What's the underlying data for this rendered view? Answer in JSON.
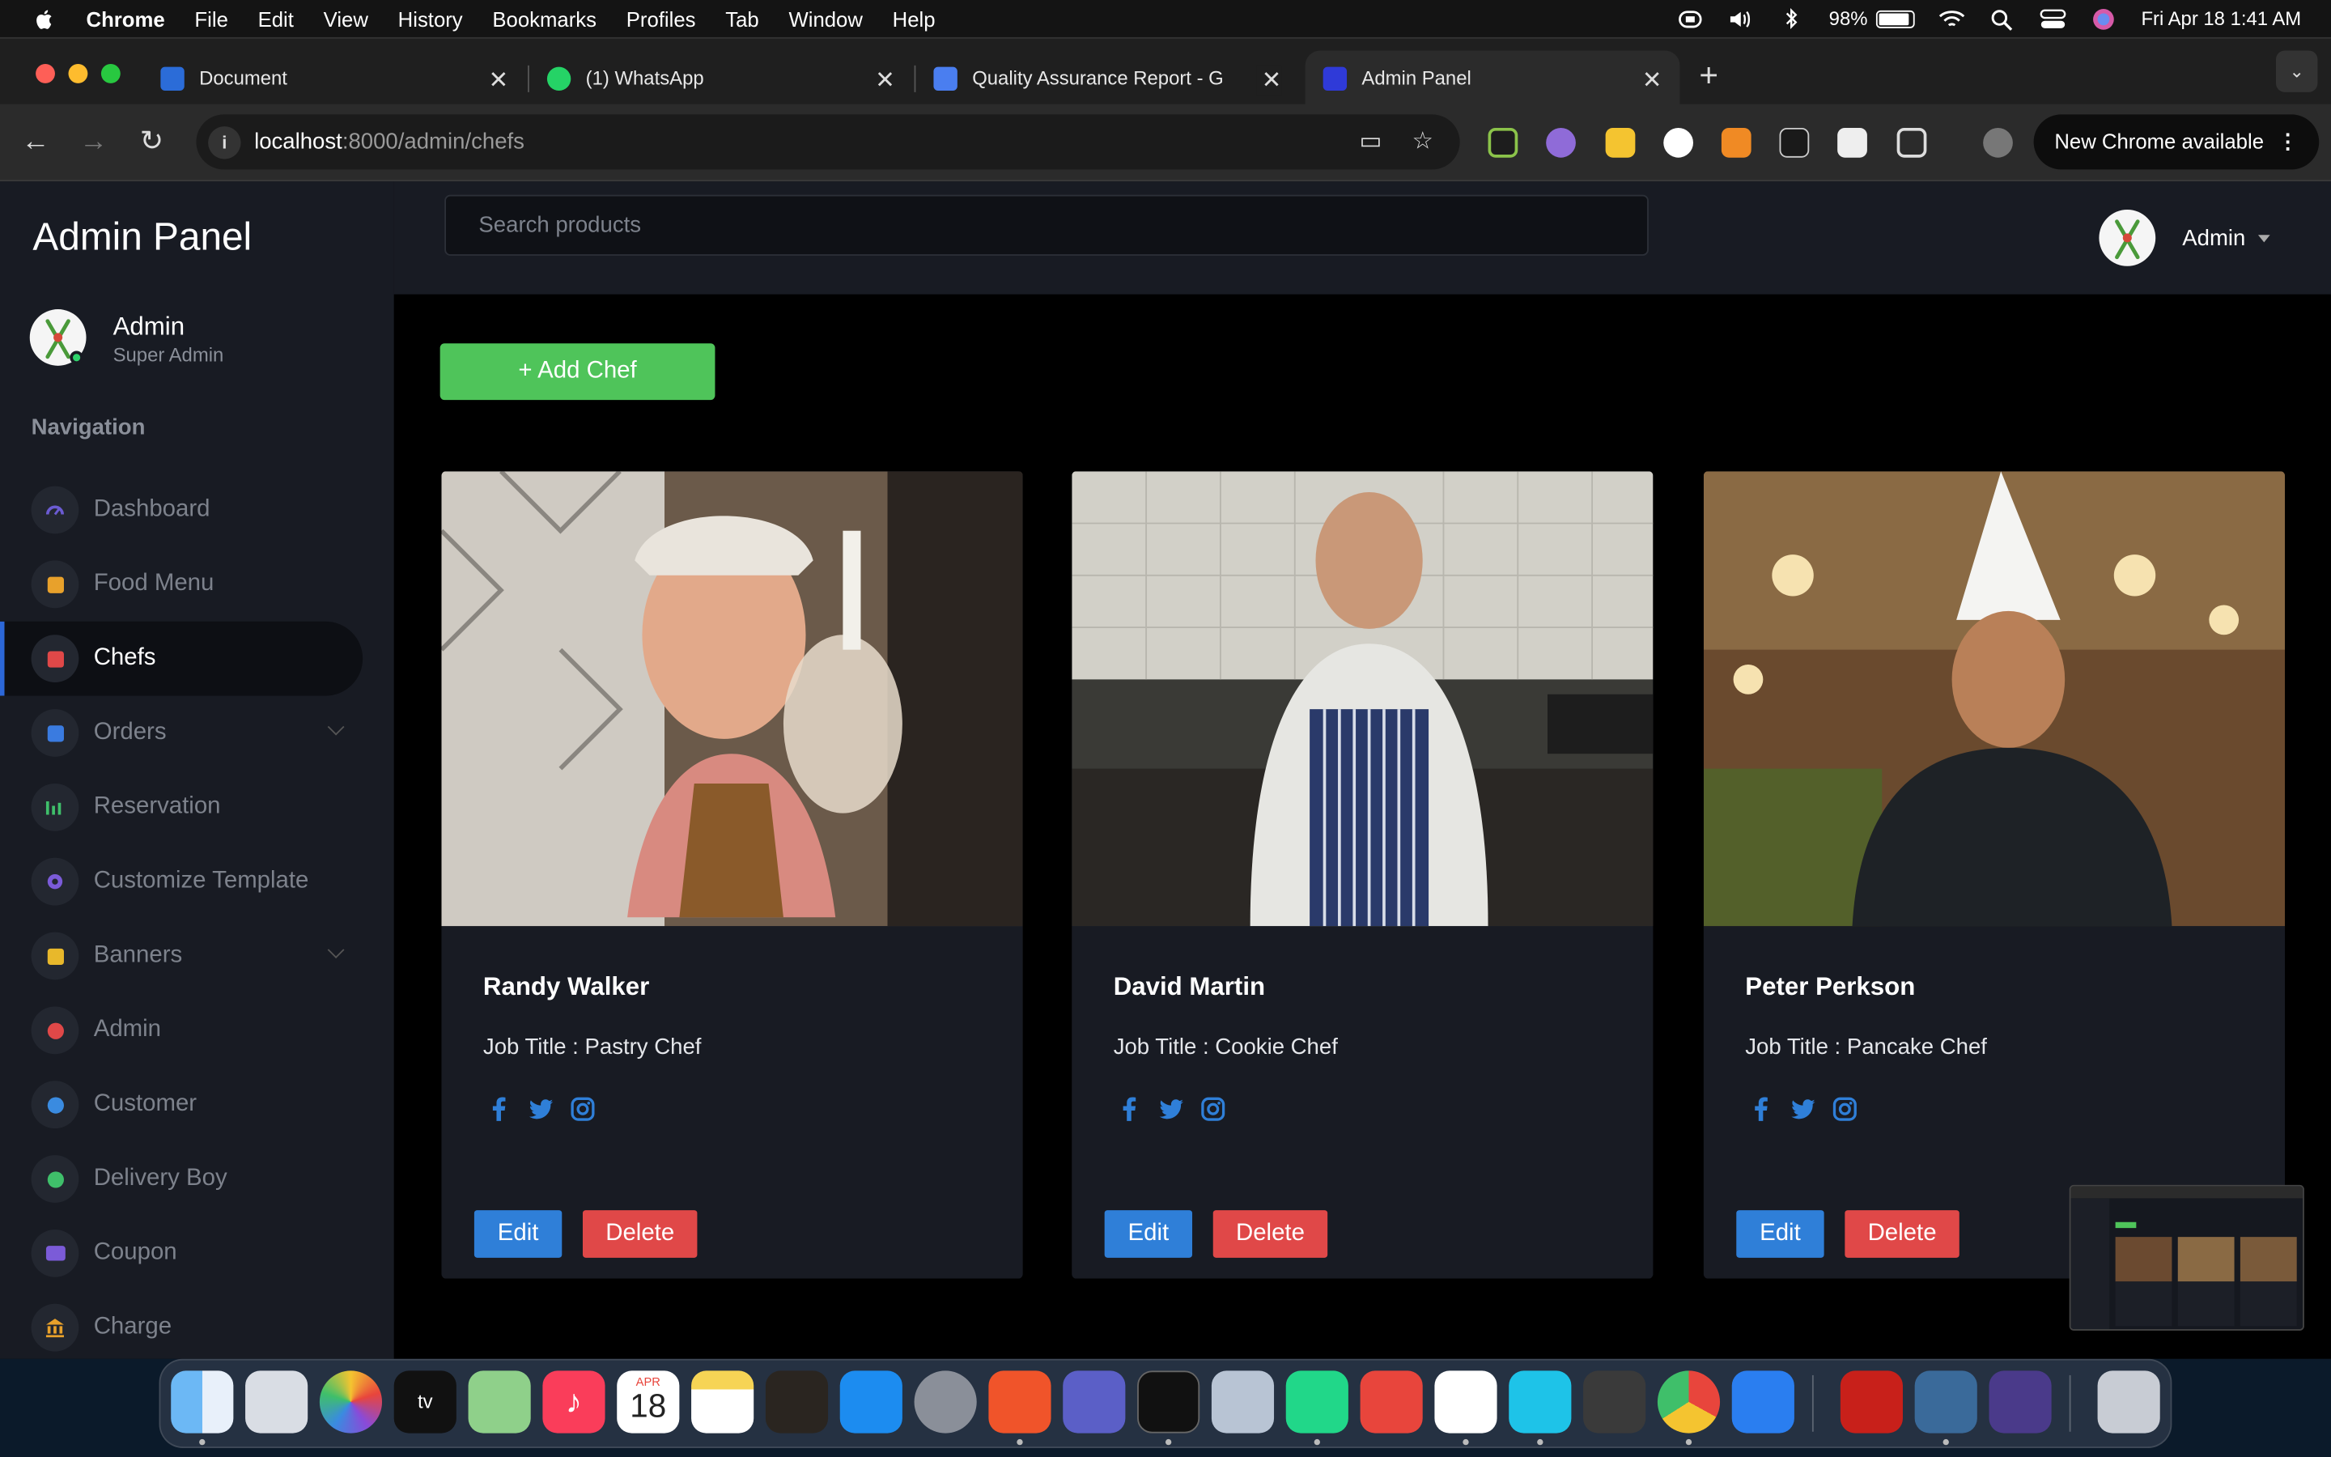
{
  "menubar": {
    "app_name": "Chrome",
    "items": [
      "File",
      "Edit",
      "View",
      "History",
      "Bookmarks",
      "Profiles",
      "Tab",
      "Window",
      "Help"
    ],
    "battery": "98%",
    "datetime": "Fri Apr 18  1:41 AM"
  },
  "tabs": [
    {
      "title": "Document",
      "favicon_color": "#2b6cd8"
    },
    {
      "title": "(1) WhatsApp",
      "favicon_color": "#25d366"
    },
    {
      "title": "Quality Assurance Report - G",
      "favicon_color": "#4a7ef0"
    },
    {
      "title": "Admin Panel",
      "favicon_color": "#2f3ad8",
      "active": true
    }
  ],
  "toolbar": {
    "url_host": "localhost",
    "url_path": ":8000/admin/chefs",
    "new_chrome_label": "New Chrome available",
    "extensions": [
      "chart-ext",
      "cloud-ext",
      "s-ext",
      "speed-ext",
      "orange-ext",
      "dots-ext",
      "grid-ext",
      "puzzle-icon",
      "profile-avatar"
    ]
  },
  "sidebar": {
    "brand": "Admin Panel",
    "user_name": "Admin",
    "user_role": "Super Admin",
    "nav_label": "Navigation",
    "items": [
      {
        "label": "Dashboard",
        "icon": "gauge-icon",
        "color": "#6b5bd2"
      },
      {
        "label": "Food Menu",
        "icon": "truck-icon",
        "color": "#e8a12b"
      },
      {
        "label": "Chefs",
        "icon": "chef-truck-icon",
        "color": "#e04848",
        "active": true
      },
      {
        "label": "Orders",
        "icon": "clipboard-icon",
        "color": "#3a7be0",
        "expandable": true
      },
      {
        "label": "Reservation",
        "icon": "bar-chart-icon",
        "color": "#3fbf6a"
      },
      {
        "label": "Customize Template",
        "icon": "gear-icon",
        "color": "#7b5bd8"
      },
      {
        "label": "Banners",
        "icon": "banner-icon",
        "color": "#e8b82b",
        "expandable": true
      },
      {
        "label": "Admin",
        "icon": "users-icon",
        "color": "#e04848"
      },
      {
        "label": "Customer",
        "icon": "user-icon",
        "color": "#3a8be0"
      },
      {
        "label": "Delivery Boy",
        "icon": "user-plus-icon",
        "color": "#3fbf6a"
      },
      {
        "label": "Coupon",
        "icon": "id-card-icon",
        "color": "#7b5bd8"
      },
      {
        "label": "Charge",
        "icon": "bank-icon",
        "color": "#e8a12b"
      }
    ]
  },
  "header": {
    "search_placeholder": "Search products",
    "user_label": "Admin"
  },
  "content": {
    "add_button": "+ Add Chef",
    "edit_label": "Edit",
    "delete_label": "Delete",
    "chefs": [
      {
        "name": "Randy Walker",
        "job": "Job Title : Pastry Chef"
      },
      {
        "name": "David Martin",
        "job": "Job Title : Cookie Chef"
      },
      {
        "name": "Peter Perkson",
        "job": "Job Title : Pancake Chef"
      }
    ]
  },
  "dock": {
    "apps": [
      "finder-icon",
      "launchpad-icon",
      "photos-icon",
      "apple-tv-icon",
      "maps-icon",
      "music-icon",
      "calendar-icon",
      "notes-icon",
      "garageband-icon",
      "app-store-icon",
      "system-settings-icon",
      "brave-icon",
      "teams-icon",
      "terminal-icon",
      "database-icon",
      "pycharm-icon",
      "intellij-icon",
      "vscode-icon",
      "webstorm-icon",
      "tableplus-icon",
      "chrome-icon",
      "xcode-instruments-icon",
      "acrobat-icon",
      "mysql-workbench-icon",
      "db-tool-icon",
      "trash-icon"
    ],
    "calendar_month": "APR",
    "calendar_day": "18"
  }
}
